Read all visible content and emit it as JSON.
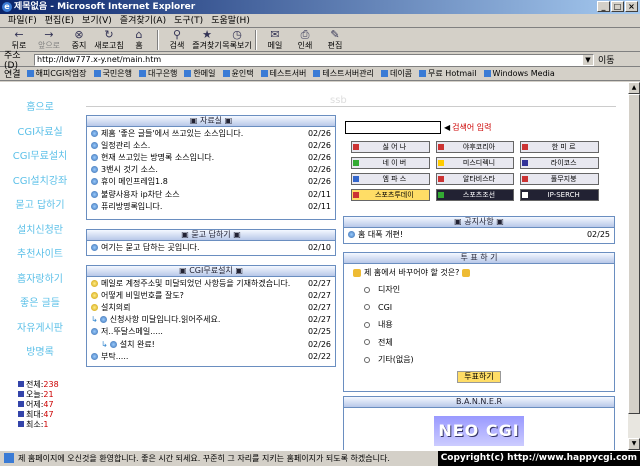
{
  "window": {
    "title": "제목없음 - Microsoft Internet Explorer"
  },
  "menu": [
    "파일(F)",
    "편집(E)",
    "보기(V)",
    "즐겨찾기(A)",
    "도구(T)",
    "도움말(H)"
  ],
  "toolbar": [
    {
      "label": "뒤로",
      "icon": "back-icon"
    },
    {
      "label": "앞으로",
      "icon": "forward-icon"
    },
    {
      "label": "중지",
      "icon": "stop-icon"
    },
    {
      "label": "새로고침",
      "icon": "refresh-icon"
    },
    {
      "label": "홈",
      "icon": "home-icon"
    },
    {
      "label": "검색",
      "icon": "search-icon"
    },
    {
      "label": "즐겨찾기",
      "icon": "favorites-icon"
    },
    {
      "label": "목록보기",
      "icon": "history-icon"
    },
    {
      "label": "메일",
      "icon": "mail-icon"
    },
    {
      "label": "인쇄",
      "icon": "print-icon"
    },
    {
      "label": "편집",
      "icon": "edit-icon"
    }
  ],
  "address": {
    "label": "주소(D)",
    "value": "http://ldw777.x-y.net/main.htm",
    "go": "이동"
  },
  "links": {
    "label": "연결",
    "items": [
      "해피CGI작업장",
      "국민은행",
      "대구은행",
      "한메일",
      "윤인택",
      "테스트서버",
      "테스트서버관리",
      "데이콤",
      "무료 Hotmail",
      "Windows Media"
    ]
  },
  "nav": [
    "홈으로",
    "CGI자료실",
    "CGI무료설치",
    "CGI설치강좌",
    "묻고 답하기",
    "설치신청란",
    "추천사이트",
    "홈자랑하기",
    "좋은 글들",
    "자유게시판",
    "방명록"
  ],
  "stats": [
    {
      "label": "전체:",
      "value": "238"
    },
    {
      "label": "오늘:",
      "value": "21"
    },
    {
      "label": "어제:",
      "value": "47"
    },
    {
      "label": "최대:",
      "value": "47"
    },
    {
      "label": "최소:",
      "value": "1"
    }
  ],
  "faint": "ssb",
  "panels": {
    "data": {
      "title": "자료실",
      "rows": [
        {
          "t": "제홈 '좋은 글들'에서 쓰고있는 소스입니다.",
          "d": "02/26"
        },
        {
          "t": "일정관리 소스.",
          "d": "02/26"
        },
        {
          "t": "현재 쓰고있는 방명록 소스입니다.",
          "d": "02/26"
        },
        {
          "t": "3밴시 것기 소스.",
          "d": "02/26"
        },
        {
          "t": "휴이 메인프레임1.8",
          "d": "02/26"
        },
        {
          "t": "불량사용자 ip차단 소스",
          "d": "02/11"
        },
        {
          "t": "퓨리방명록입니다.",
          "d": "02/11"
        }
      ]
    },
    "qa": {
      "title": "묻고 답하기",
      "rows": [
        {
          "t": "여기는 묻고 답하는 곳입니다.",
          "d": "02/10"
        }
      ]
    },
    "install": {
      "title": "CGI무료설치",
      "rows": [
        {
          "t": "메일로 계정주소및 미달되었던 사항등을 기재하겠습니다.",
          "d": "02/27",
          "y": true
        },
        {
          "t": "어떻게 비밀번호를 잘도?",
          "d": "02/27",
          "y": true
        },
        {
          "t": "설치의뢰",
          "d": "02/27",
          "y": true
        },
        {
          "t": "신청사항 미달입니다.읽어주세요.",
          "d": "02/27",
          "re": true
        },
        {
          "t": "저..뚜달스메일.....",
          "d": "02/25"
        },
        {
          "t": "설치 완료!",
          "d": "02/26",
          "re": true,
          "deep": true
        },
        {
          "t": "부탁.....",
          "d": "02/22"
        }
      ]
    },
    "notice": {
      "title": "공지사항",
      "rows": [
        {
          "t": "홈 대폭 개편!",
          "d": "02/25"
        }
      ]
    }
  },
  "search": {
    "label": "검색어 입력"
  },
  "grid": [
    {
      "l": "싫 어 나",
      "c": "#c33"
    },
    {
      "l": "야후코리아",
      "c": "#c33"
    },
    {
      "l": "한 미 르",
      "c": "#c33"
    },
    {
      "l": "네 이 버",
      "c": "#3a3"
    },
    {
      "l": "미스디렉니",
      "c": "#fc0"
    },
    {
      "l": "라이코스",
      "c": "#339"
    },
    {
      "l": "엠 파 스",
      "c": "#36c"
    },
    {
      "l": "알타비스타",
      "c": "#c33"
    },
    {
      "l": "풀무지붕",
      "c": "#c33"
    },
    {
      "l": "스포츠투데이",
      "c": "#c33",
      "cls": "yel"
    },
    {
      "l": "스포츠조선",
      "c": "#3a3",
      "cls": "dark"
    },
    {
      "l": "IP-SERCH",
      "c": "#fff",
      "cls": "dark"
    }
  ],
  "vote": {
    "title": "투 표 하 기",
    "question": "제 홈에서 바꾸어야 할 것은?",
    "options": [
      "디자인",
      "CGI",
      "내용",
      "전체",
      "기타(없음)"
    ],
    "button": "투표하기"
  },
  "banner": {
    "title": "B.A.N.N.E.R",
    "img": "NEO CGI"
  },
  "status": {
    "text": "제 홈페이지에 오신것을 환영합니다. 좋은 시간 되세요. 꾸준히 그 자리를 지키는 홈페이지가 되도록 하겠습니다.",
    "copyright": "Copyright(c) http://www.happycgi.com"
  }
}
